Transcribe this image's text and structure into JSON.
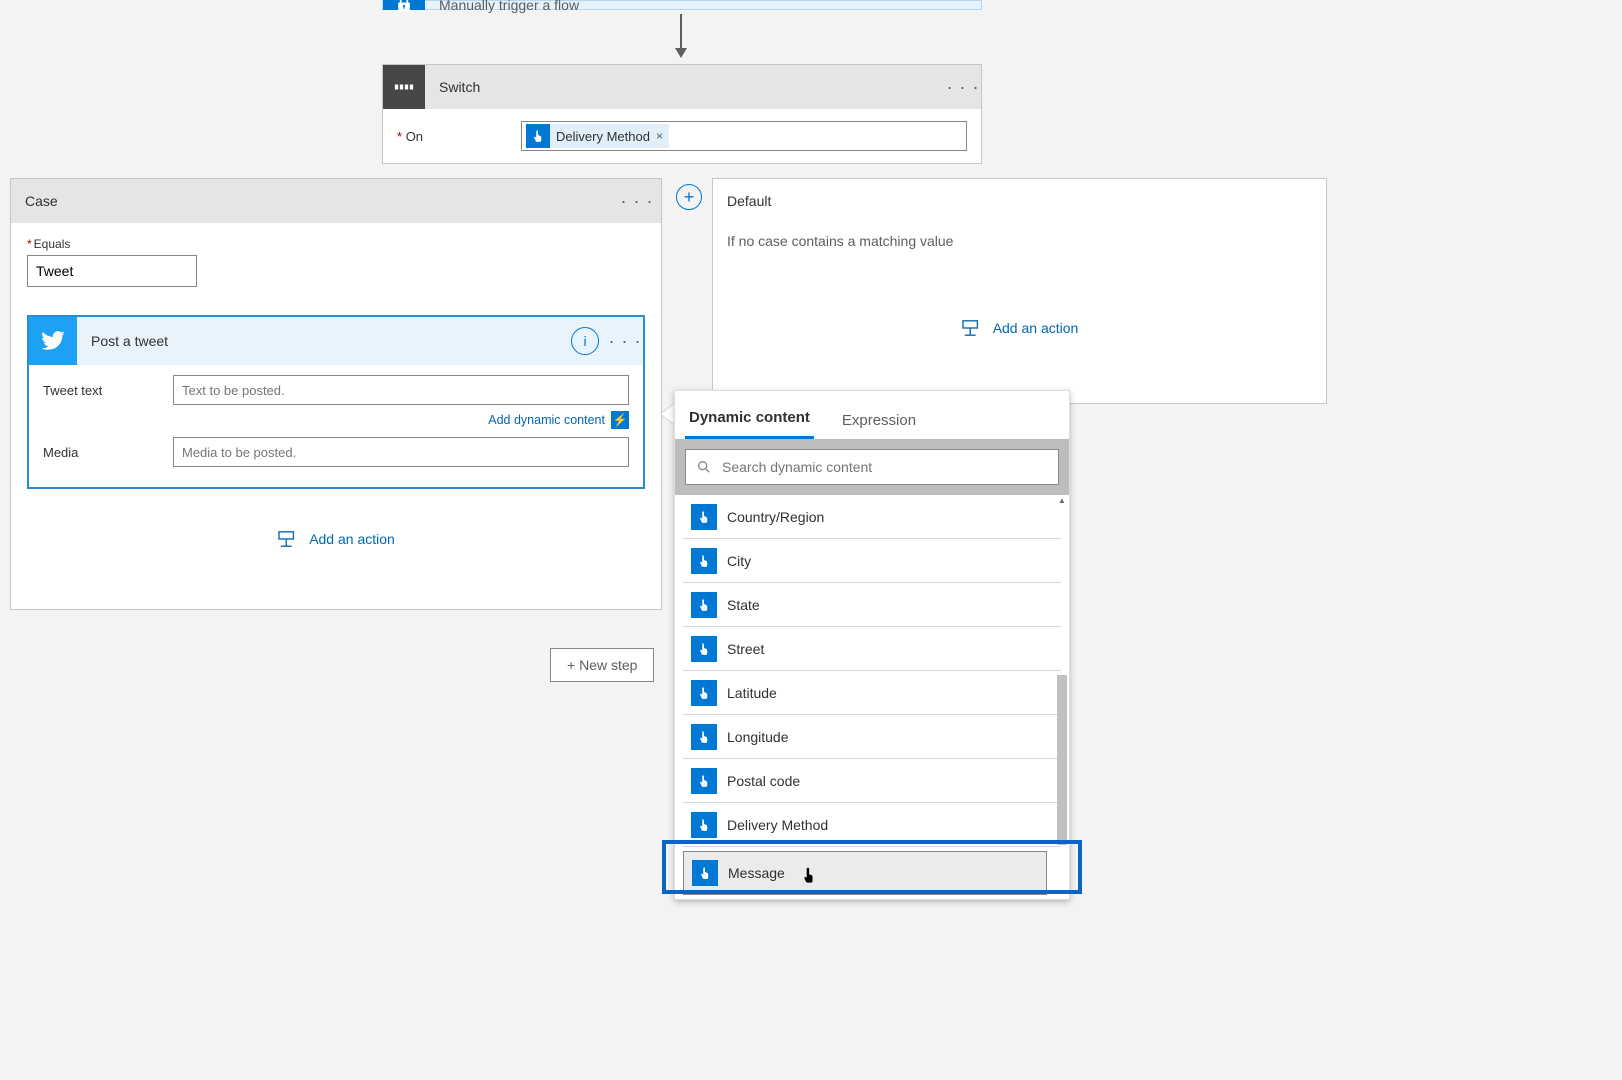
{
  "trigger": {
    "title": "Manually trigger a flow"
  },
  "switch": {
    "title": "Switch",
    "onLabel": "On",
    "token": "Delivery Method"
  },
  "case": {
    "title": "Case",
    "equalsLabel": "Equals",
    "equalsValue": "Tweet",
    "action": {
      "title": "Post a tweet",
      "tweetTextLabel": "Tweet text",
      "tweetTextPlaceholder": "Text to be posted.",
      "mediaLabel": "Media",
      "mediaPlaceholder": "Media to be posted.",
      "addDynamic": "Add dynamic content"
    },
    "addAction": "Add an action"
  },
  "default": {
    "title": "Default",
    "desc": "If no case contains a matching value",
    "addAction": "Add an action"
  },
  "newStep": "+ New step",
  "dc": {
    "tab1": "Dynamic content",
    "tab2": "Expression",
    "searchPlaceholder": "Search dynamic content",
    "items": [
      "Country/Region",
      "City",
      "State",
      "Street",
      "Latitude",
      "Longitude",
      "Postal code",
      "Delivery Method",
      "Message"
    ]
  }
}
